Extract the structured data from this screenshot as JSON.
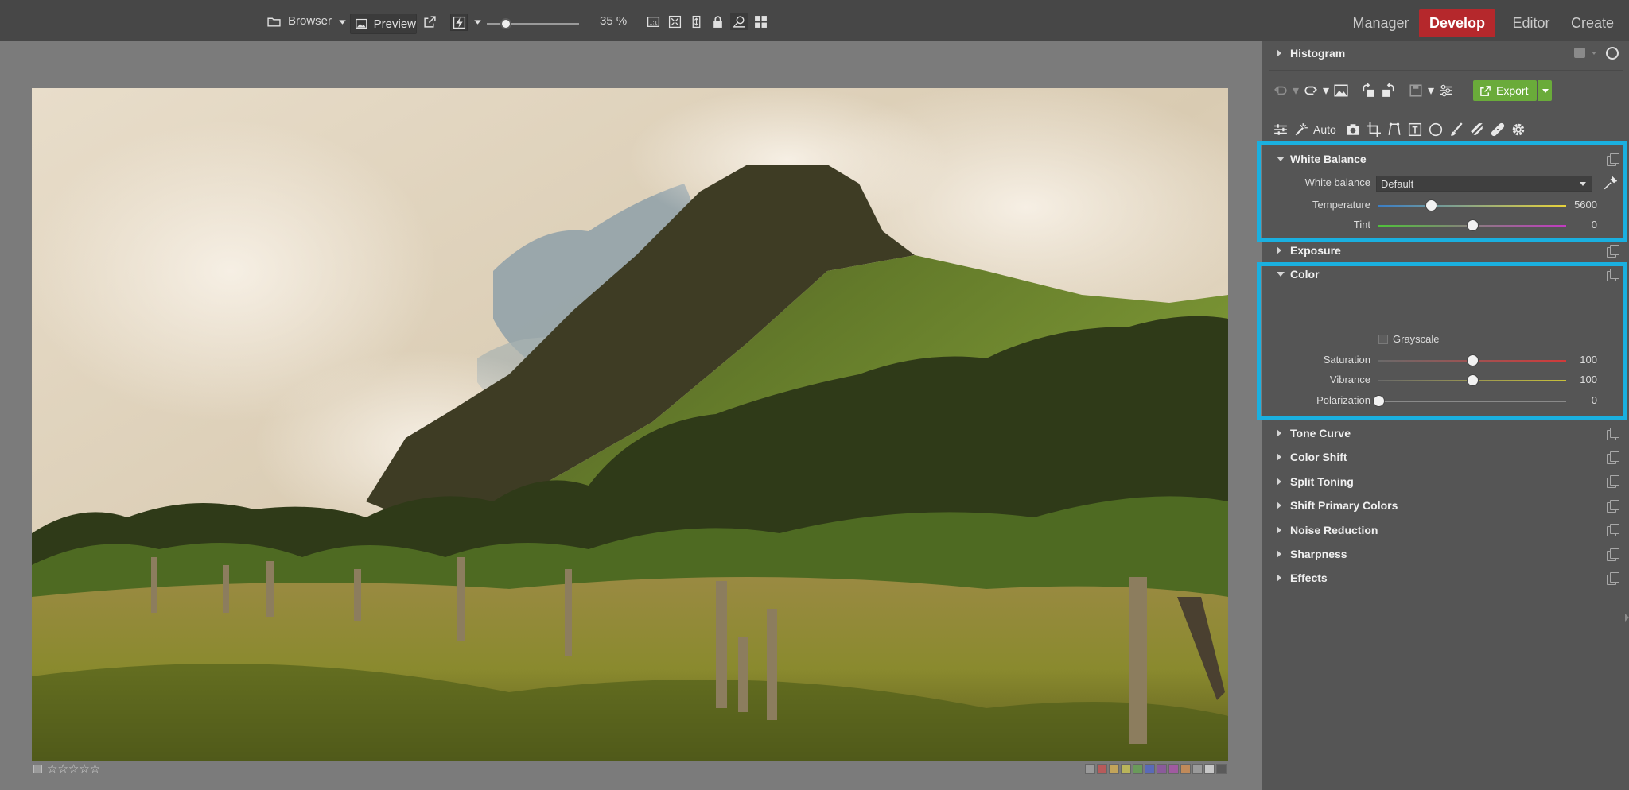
{
  "topbar": {
    "browser_label": "Browser",
    "preview_label": "Preview",
    "zoom_value": "35 %",
    "zoom_fraction": 0.21,
    "modes": [
      {
        "label": "Manager"
      },
      {
        "label": "Develop"
      },
      {
        "label": "Editor"
      },
      {
        "label": "Create"
      }
    ],
    "active_mode": "Develop",
    "accent_color": "#b5282c"
  },
  "panel": {
    "histogram_label": "Histogram",
    "export_label": "Export",
    "auto_label": "Auto",
    "white_balance": {
      "title": "White Balance",
      "wb_label": "White balance",
      "wb_value": "Default",
      "temperature_label": "Temperature",
      "temperature_value": "5600",
      "temperature_fraction": 0.28,
      "tint_label": "Tint",
      "tint_value": "0",
      "tint_fraction": 0.5
    },
    "exposure_label": "Exposure",
    "color": {
      "title": "Color",
      "grayscale_label": "Grayscale",
      "saturation_label": "Saturation",
      "saturation_value": "100",
      "saturation_fraction": 0.5,
      "vibrance_label": "Vibrance",
      "vibrance_value": "100",
      "vibrance_fraction": 0.5,
      "polarization_label": "Polarization",
      "polarization_value": "0",
      "polarization_fraction": 0.0
    },
    "sections": [
      {
        "label": "Tone Curve"
      },
      {
        "label": "Color Shift"
      },
      {
        "label": "Split Toning"
      },
      {
        "label": "Shift Primary Colors"
      },
      {
        "label": "Noise Reduction"
      },
      {
        "label": "Sharpness"
      },
      {
        "label": "Effects"
      }
    ],
    "highlight_color": "#1ab0e0",
    "export_color": "#6aab3a"
  },
  "footer": {
    "stars": "☆☆☆☆☆",
    "color_labels": [
      "#9a9a9a",
      "#b75a5a",
      "#c2a45a",
      "#b9b45a",
      "#6a9a5a",
      "#5a6ab7",
      "#8a5a9a",
      "#a05aa0",
      "#c08a5a",
      "#9a9a9a",
      "#c8c8c8",
      "#5a5a5a"
    ]
  }
}
